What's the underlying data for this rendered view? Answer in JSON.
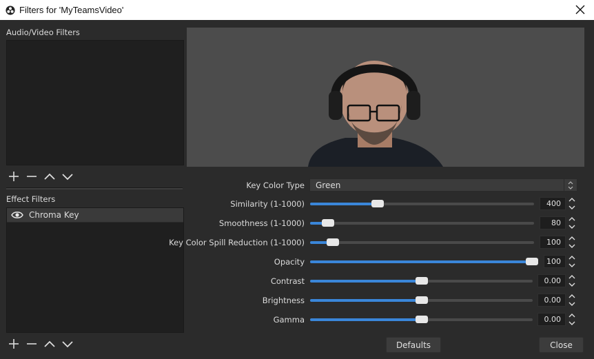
{
  "window": {
    "title": "Filters for 'MyTeamsVideo'"
  },
  "left": {
    "audio_video_label": "Audio/Video Filters",
    "effect_filters_label": "Effect Filters",
    "effect_items": [
      {
        "label": "Chroma Key",
        "visible": true
      }
    ]
  },
  "properties": {
    "key_color_type": {
      "label": "Key Color Type",
      "value": "Green"
    },
    "sliders": [
      {
        "label": "Similarity (1-1000)",
        "value": "400",
        "fraction": 0.3
      },
      {
        "label": "Smoothness (1-1000)",
        "value": "80",
        "fraction": 0.08
      },
      {
        "label": "Key Color Spill Reduction (1-1000)",
        "value": "100",
        "fraction": 0.1
      },
      {
        "label": "Opacity",
        "value": "100",
        "fraction": 1.0
      },
      {
        "label": "Contrast",
        "value": "0.00",
        "fraction": 0.5
      },
      {
        "label": "Brightness",
        "value": "0.00",
        "fraction": 0.5
      },
      {
        "label": "Gamma",
        "value": "0.00",
        "fraction": 0.5
      }
    ]
  },
  "buttons": {
    "defaults": "Defaults",
    "close": "Close"
  },
  "colors": {
    "accent": "#3a86d9",
    "background": "#2b2b2b",
    "list_bg": "#1f1f1f",
    "preview_bg": "#4c4c4c"
  }
}
